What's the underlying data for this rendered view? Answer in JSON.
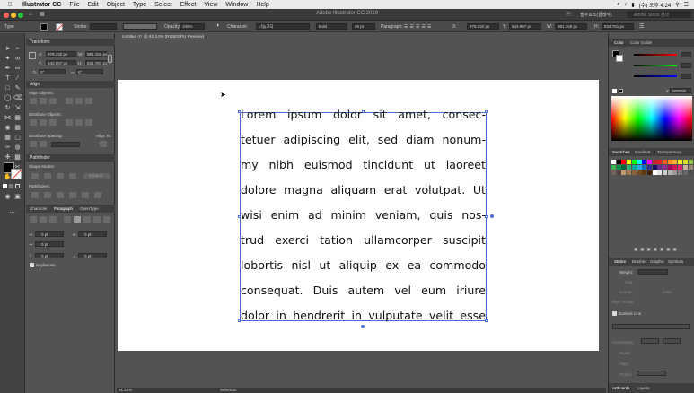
{
  "menubar": {
    "app_name": "Illustrator CC",
    "items": [
      "File",
      "Edit",
      "Object",
      "Type",
      "Select",
      "Effect",
      "View",
      "Window",
      "Help"
    ],
    "clock": "(수) 오후 4:24"
  },
  "titlebar": {
    "title": "Adobe Illustrator CC 2019",
    "workspace": "필수요소(클래식)",
    "search_placeholder": "Adobe Stock 검색"
  },
  "controlbar": {
    "selection": "Type",
    "stroke_label": "Stroke:",
    "opacity_label": "Opacity:",
    "opacity_value": "100%",
    "character_label": "Character:",
    "font": "나눔고딕",
    "weight": "Bold",
    "size": "45 pt",
    "paragraph_label": "Paragraph:",
    "x": "979.232 px",
    "y": "543.957 px",
    "w": "981.159 px",
    "h": "834.781 px"
  },
  "transform_panel": {
    "title": "Transform",
    "x_label": "X:",
    "x_value": "979.232 px",
    "y_label": "Y:",
    "y_value": "543.957 px",
    "w_label": "W:",
    "w_value": "981.159 px",
    "h_label": "H:",
    "h_value": "834.781 px",
    "angle": "0°",
    "shear": "0°"
  },
  "align_panel": {
    "title": "Align",
    "align_objects": "Align Objects:",
    "distribute_objects": "Distribute Objects:",
    "distribute_spacing": "Distribute Spacing:",
    "align_to": "Align To:"
  },
  "pathfinder_panel": {
    "title": "Pathfinder",
    "shape_modes": "Shape Modes:",
    "pathfinders": "Pathfinders:",
    "expand": "Expand"
  },
  "paragraph_panel": {
    "tabs": [
      "Character",
      "Paragraph",
      "OpenType"
    ],
    "left_indent": "0 pt",
    "right_indent": "0 pt",
    "first_line": "0 pt",
    "space_before": "0 pt",
    "space_after": "0 pt",
    "hyphenate": "Hyphenate"
  },
  "document": {
    "tab_title": "Untitled-1* @ 61.14% (RGB/GPU Preview)",
    "zoom": "61.14%",
    "status": "Selection",
    "lines": [
      "Lorem ipsum dolor sit amet, consec-",
      "tetuer adipiscing elit, sed diam nonum-",
      "my nibh euismod tincidunt ut laoreet",
      "dolore magna aliquam erat volutpat. Ut",
      "wisi enim ad minim veniam, quis nos-",
      "trud exerci tation ullamcorper suscipit",
      "lobortis nisl ut aliquip ex ea commodo",
      "consequat. Duis autem vel eum iriure",
      "dolor in hendrerit in vulputate velit esse"
    ]
  },
  "right_panels": {
    "color_tabs": [
      "Color",
      "Color Guide"
    ],
    "hex": "000000",
    "swatch_tabs": [
      "Swatches",
      "Gradient",
      "Transparency"
    ],
    "stroke_tabs": [
      "Stroke",
      "Brushes",
      "Graphic",
      "Symbols"
    ],
    "weight_label": "Weight:",
    "cap_label": "Cap:",
    "corner_label": "Corner:",
    "limit_label": "Limit:",
    "align_stroke_label": "Align Stroke:",
    "dashed_line": "Dashed Line",
    "arrowheads": "Arrowheads:",
    "scale": "Scale:",
    "align": "Align:",
    "profile": "Profile:",
    "bottom_tabs": [
      "Artboards",
      "Layers"
    ]
  },
  "colors": {
    "accent": "#4d6bd6",
    "panel": "#535353",
    "artboard": "#ffffff"
  }
}
